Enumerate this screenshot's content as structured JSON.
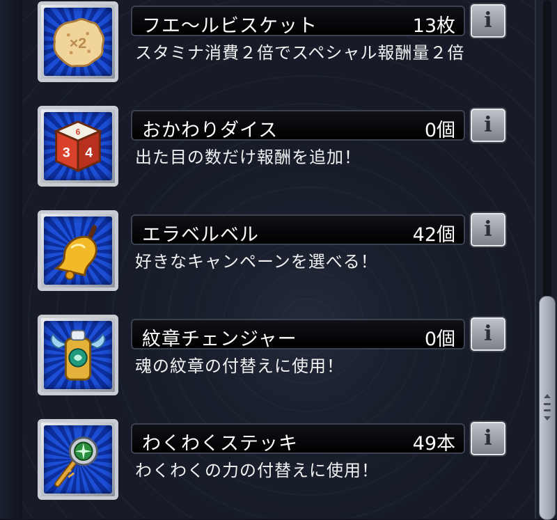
{
  "items": [
    {
      "name": "フエ〜ルビスケット",
      "count": "13枚",
      "description": "スタミナ消費２倍でスペシャル報酬量２倍",
      "icon": "biscuit-icon"
    },
    {
      "name": "おかわりダイス",
      "count": "0個",
      "description": "出た目の数だけ報酬を追加！",
      "icon": "dice-icon"
    },
    {
      "name": "エラベルベル",
      "count": "42個",
      "description": "好きなキャンペーンを選べる！",
      "icon": "bell-icon"
    },
    {
      "name": "紋章チェンジャー",
      "count": "0個",
      "description": "魂の紋章の付替えに使用！",
      "icon": "emblem-changer-icon"
    },
    {
      "name": "わくわくステッキ",
      "count": "49本",
      "description": "わくわくの力の付替えに使用！",
      "icon": "stick-icon"
    }
  ],
  "info_glyph": "i",
  "dice_faces": [
    "3",
    "4",
    "6"
  ],
  "biscuit_text": "×2",
  "scrollbar": {
    "position": 0.85
  }
}
